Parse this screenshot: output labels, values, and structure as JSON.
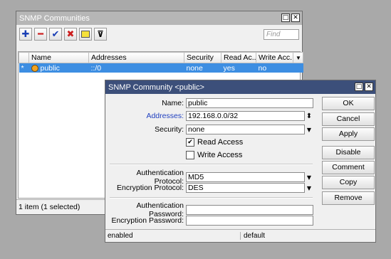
{
  "list_window": {
    "title": "SNMP Communities",
    "find_placeholder": "Find",
    "columns": [
      "Name",
      "Addresses",
      "Security",
      "Read Ac...",
      "Write Acc..."
    ],
    "row": {
      "marker": "*",
      "name": "public",
      "addresses": "::/0",
      "security": "none",
      "read": "yes",
      "write": "no"
    },
    "status": "1 item (1 selected)"
  },
  "dialog": {
    "title": "SNMP Community <public>",
    "fields": {
      "name_label": "Name:",
      "name": "public",
      "addresses_label": "Addresses:",
      "addresses": "192.168.0.0/32",
      "security_label": "Security:",
      "security": "none",
      "read_access": "Read Access",
      "write_access": "Write Access",
      "auth_protocol_label": "Authentication Protocol:",
      "auth_protocol": "MD5",
      "enc_protocol_label": "Encryption Protocol:",
      "enc_protocol": "DES",
      "auth_password_label": "Authentication Password:",
      "auth_password": "",
      "enc_password_label": "Encryption Password:",
      "enc_password": ""
    },
    "buttons": [
      "OK",
      "Cancel",
      "Apply",
      "Disable",
      "Comment",
      "Copy",
      "Remove"
    ],
    "status_left": "enabled",
    "status_right": "default"
  },
  "colors": {
    "selection": "#3d8ee2",
    "dialog_title": "#3c4f7a",
    "link_label": "#1f3fbf"
  }
}
